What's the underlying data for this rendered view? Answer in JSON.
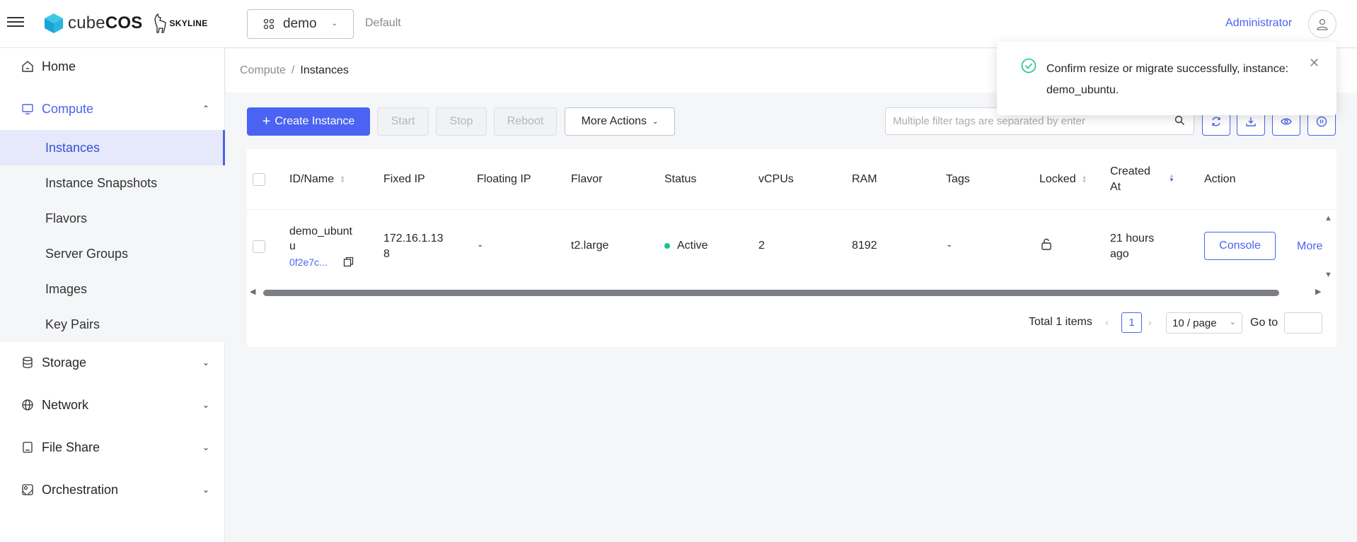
{
  "header": {
    "logo_cube_text": "cube",
    "logo_cos_text": "COS",
    "skyline_text": "SKYLINE",
    "project": "demo",
    "domain": "Default",
    "user": "Administrator"
  },
  "sidebar": {
    "home": "Home",
    "compute": "Compute",
    "compute_items": [
      "Instances",
      "Instance Snapshots",
      "Flavors",
      "Server Groups",
      "Images",
      "Key Pairs"
    ],
    "storage": "Storage",
    "network": "Network",
    "file_share": "File Share",
    "orchestration": "Orchestration"
  },
  "breadcrumb": {
    "parent": "Compute",
    "separator": "/",
    "current": "Instances"
  },
  "toolbar": {
    "create": "Create Instance",
    "start": "Start",
    "stop": "Stop",
    "reboot": "Reboot",
    "more_actions": "More Actions",
    "search_placeholder": "Multiple filter tags are separated by enter"
  },
  "table": {
    "columns": {
      "id_name": "ID/Name",
      "fixed_ip": "Fixed IP",
      "floating_ip": "Floating IP",
      "flavor": "Flavor",
      "status": "Status",
      "vcpus": "vCPUs",
      "ram": "RAM",
      "tags": "Tags",
      "locked": "Locked",
      "created_at_1": "Created",
      "created_at_2": "At",
      "action": "Action"
    },
    "row": {
      "name_line1": "demo_ubunt",
      "name_line2": "u",
      "id_short": "0f2e7c...",
      "fixed_ip_line1": "172.16.1.13",
      "fixed_ip_line2": "8",
      "floating_ip": "-",
      "flavor": "t2.large",
      "status": "Active",
      "vcpus": "2",
      "ram": "8192",
      "tags": "-",
      "created_line1": "21 hours",
      "created_line2": "ago",
      "console": "Console",
      "more": "More"
    }
  },
  "pagination": {
    "total": "Total 1 items",
    "page": "1",
    "page_size": "10 / page",
    "goto": "Go to"
  },
  "toast": {
    "message_line1": "Confirm resize or migrate successfully, instance:",
    "message_line2": "demo_ubuntu."
  },
  "colors": {
    "accent": "#4a63f2",
    "success": "#1cc28f",
    "selected_bg": "#e6e9fb"
  }
}
